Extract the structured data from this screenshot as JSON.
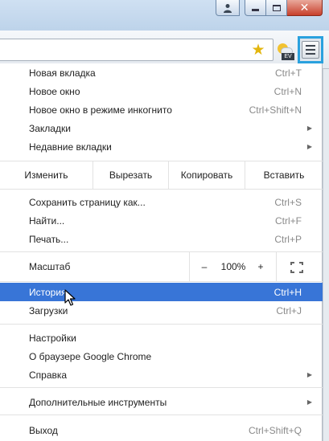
{
  "colors": {
    "highlight": "#3875d7",
    "focus_ring": "#2aa1de",
    "shortcut": "#8a8a8a",
    "star": "#e3b60e"
  },
  "toolbar": {
    "bookmark_icon": "star-icon",
    "extension_badge": "EV",
    "menu_icon": "hamburger-menu-icon"
  },
  "window": {
    "close_glyph": "✕"
  },
  "menu": {
    "group1": [
      {
        "label": "Новая вкладка",
        "shortcut": "Ctrl+T"
      },
      {
        "label": "Новое окно",
        "shortcut": "Ctrl+N"
      },
      {
        "label": "Новое окно в режиме инкогнито",
        "shortcut": "Ctrl+Shift+N"
      },
      {
        "label": "Закладки",
        "arrow": "▶"
      },
      {
        "label": "Недавние вкладки",
        "arrow": "▶"
      }
    ],
    "edit": {
      "label": "Изменить",
      "cut": "Вырезать",
      "copy": "Копировать",
      "paste": "Вставить"
    },
    "group2": [
      {
        "label": "Сохранить страницу как...",
        "shortcut": "Ctrl+S"
      },
      {
        "label": "Найти...",
        "shortcut": "Ctrl+F"
      },
      {
        "label": "Печать...",
        "shortcut": "Ctrl+P"
      }
    ],
    "zoom": {
      "label": "Масштаб",
      "minus": "–",
      "value": "100%",
      "plus": "+"
    },
    "group3": [
      {
        "label": "История",
        "shortcut": "Ctrl+H",
        "highlighted": true
      },
      {
        "label": "Загрузки",
        "shortcut": "Ctrl+J"
      }
    ],
    "group4": [
      {
        "label": "Настройки"
      },
      {
        "label": "О браузере Google Chrome"
      },
      {
        "label": "Справка",
        "arrow": "▶"
      }
    ],
    "more_tools": {
      "label": "Дополнительные инструменты",
      "arrow": "▶"
    },
    "exit": {
      "label": "Выход",
      "shortcut": "Ctrl+Shift+Q"
    }
  }
}
